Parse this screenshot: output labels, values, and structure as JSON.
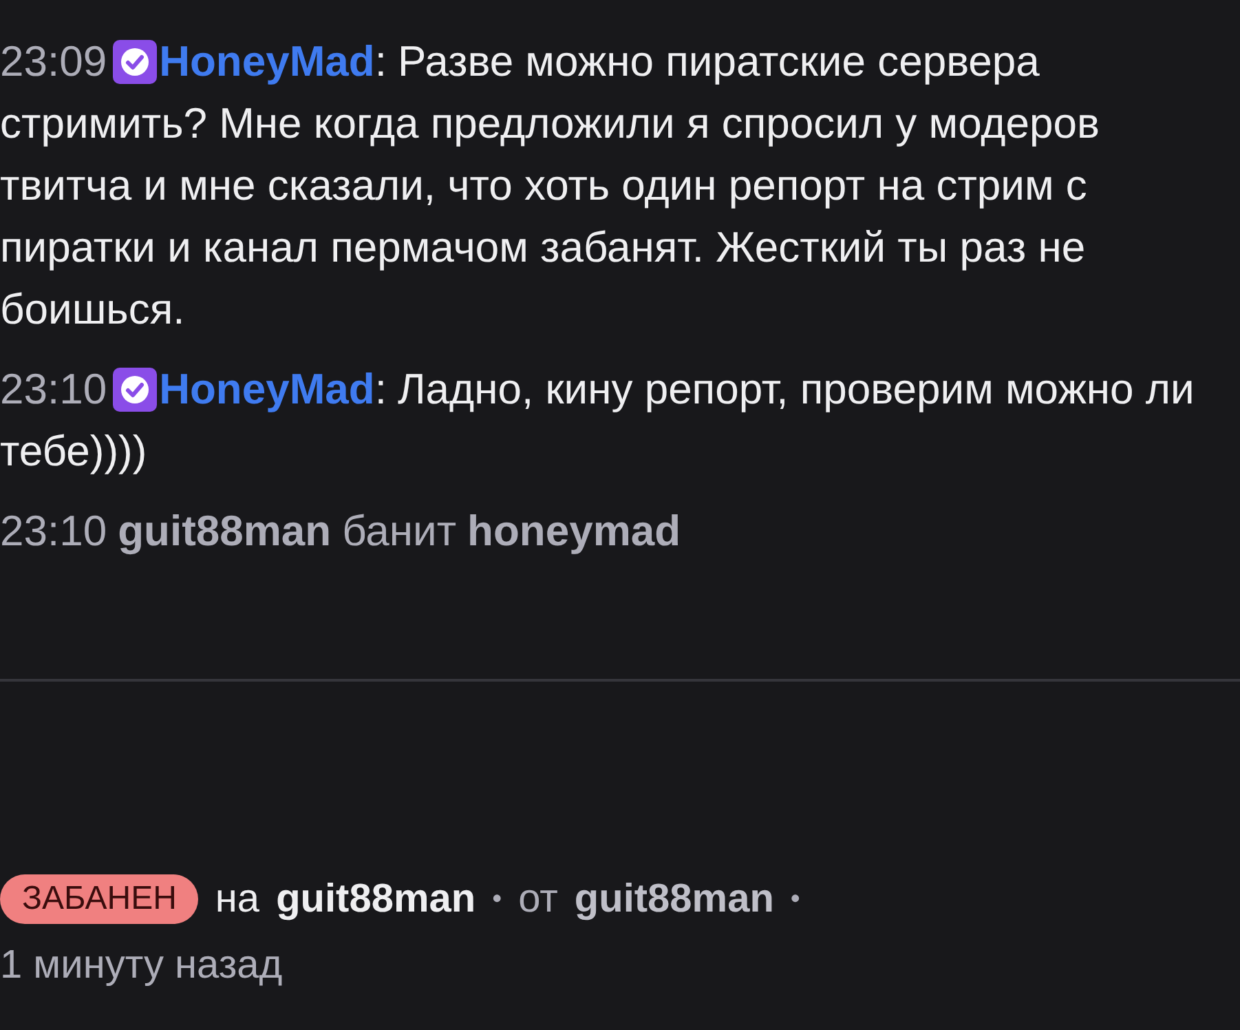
{
  "messages": [
    {
      "kind": "chat",
      "time": "23:09",
      "user": "HoneyMad",
      "separator": ":",
      "text": "Разве можно пиратские сервера стримить? Мне когда предложили я спросил у модеров твитча и мне сказали, что хоть один репорт на стрим с пиратки и канал пермачом забанят. Жесткий ты раз не боишься."
    },
    {
      "kind": "chat",
      "time": "23:10",
      "user": "HoneyMad",
      "separator": ":",
      "text": "Ладно, кину репорт, проверим можно ли тебе))))"
    },
    {
      "kind": "system",
      "time": "23:10",
      "moderator": "guit88man",
      "action": "банит",
      "target": "honeymad"
    }
  ],
  "ban_info": {
    "badge": "ЗАБАНЕН",
    "on_label": "на",
    "on_user": "guit88man",
    "separator_1": "•",
    "by_label": "от",
    "by_user": "guit88man",
    "separator_2": "•",
    "time": "1 минуту назад"
  }
}
